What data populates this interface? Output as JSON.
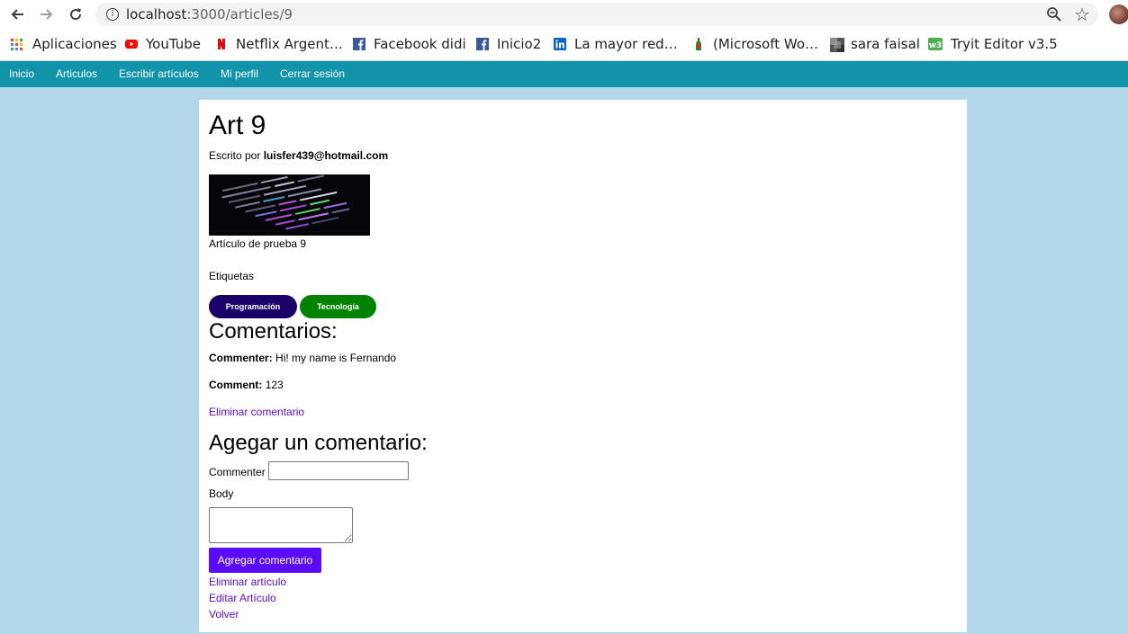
{
  "browser": {
    "url_host": "localhost",
    "url_rest": ":3000/articles/9",
    "icons": {
      "back": "back-arrow-icon",
      "forward": "forward-arrow-icon",
      "reload": "reload-icon",
      "info": "site-info-icon",
      "zoom": "zoom-icon",
      "star": "bookmark-star-icon"
    }
  },
  "bookmarks": [
    {
      "label": "Aplicaciones",
      "icon": "apps-grid-icon"
    },
    {
      "label": "YouTube",
      "icon": "youtube-icon",
      "color": "#ff0000"
    },
    {
      "label": "Netflix Argent…",
      "icon": "netflix-icon",
      "color": "#e50914"
    },
    {
      "label": "Facebook didi",
      "icon": "facebook-icon",
      "color": "#3b5998"
    },
    {
      "label": "Inicio2",
      "icon": "facebook-icon",
      "color": "#3b5998"
    },
    {
      "label": "La mayor red…",
      "icon": "linkedin-icon",
      "color": "#0a66c2"
    },
    {
      "label": "(Microsoft Wo…",
      "icon": "bottle-icon"
    },
    {
      "label": "sara faisal",
      "icon": "thumbnail-icon"
    },
    {
      "label": "Tryit Editor v3.5",
      "icon": "w3schools-icon",
      "color": "#4caf50"
    }
  ],
  "nav": {
    "items": [
      "Inicio",
      "Articulos",
      "Escribir artículos",
      "Mi perfil",
      "Cerrar sesión"
    ],
    "bg_color": "#1193a9"
  },
  "article": {
    "title": "Art 9",
    "byline_prefix": "Escrito por",
    "author": "luisfer439@hotmail.com",
    "body": "Artículo de prueba 9",
    "tags_label": "Etiquetas",
    "tags": [
      {
        "label": "Programación",
        "color": "#1b0069"
      },
      {
        "label": "Tecnología",
        "color": "#018200"
      }
    ]
  },
  "comments": {
    "title": "Comentarios:",
    "commenter_label": "Commenter:",
    "commenter_value": "Hi! my name is Fernando",
    "comment_label": "Comment:",
    "comment_value": "123",
    "delete_link": "Eliminar comentario"
  },
  "add_comment": {
    "title": "Agegar un comentario:",
    "commenter_label": "Commenter",
    "commenter_value": "",
    "body_label": "Body",
    "body_value": "",
    "submit": "Agregar comentario",
    "submit_color": "#5a0bfa"
  },
  "actions": {
    "delete_article": "Eliminar artículo",
    "edit_article": "Editar Artículo",
    "back": "Volver",
    "link_color": "#5a0bd6"
  }
}
